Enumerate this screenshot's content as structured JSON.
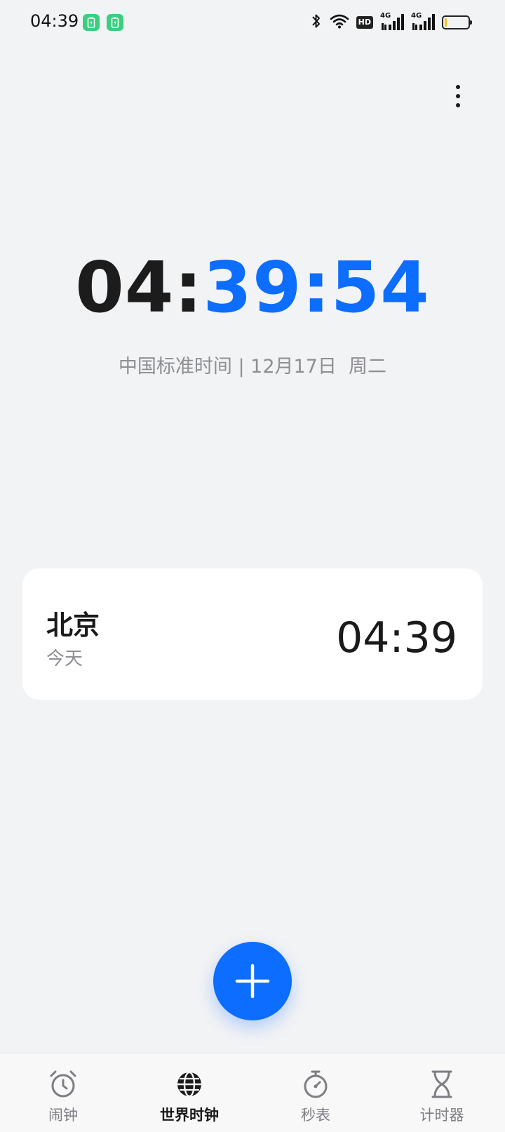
{
  "status_bar": {
    "time": "04:39",
    "hd_label": "HD",
    "signal_1_label": "4G",
    "signal_2_label": "4G"
  },
  "clock": {
    "hours": "04",
    "minutes": "39",
    "seconds": "54",
    "separator": ":",
    "timezone_date": "中国标准时间 | 12月17日  周二"
  },
  "city_card": {
    "name": "北京",
    "day": "今天",
    "time": "04:39"
  },
  "nav": {
    "tabs": [
      {
        "label": "闹钟",
        "icon": "alarm-clock-icon"
      },
      {
        "label": "世界时钟",
        "icon": "globe-icon"
      },
      {
        "label": "秒表",
        "icon": "stopwatch-icon"
      },
      {
        "label": "计时器",
        "icon": "hourglass-icon"
      }
    ],
    "active_index": 1
  },
  "colors": {
    "accent": "#0d6dff",
    "background": "#f2f3f5",
    "card": "#ffffff",
    "secondary_text": "#8e8e93",
    "notification_badge": "#3ccd7e"
  }
}
